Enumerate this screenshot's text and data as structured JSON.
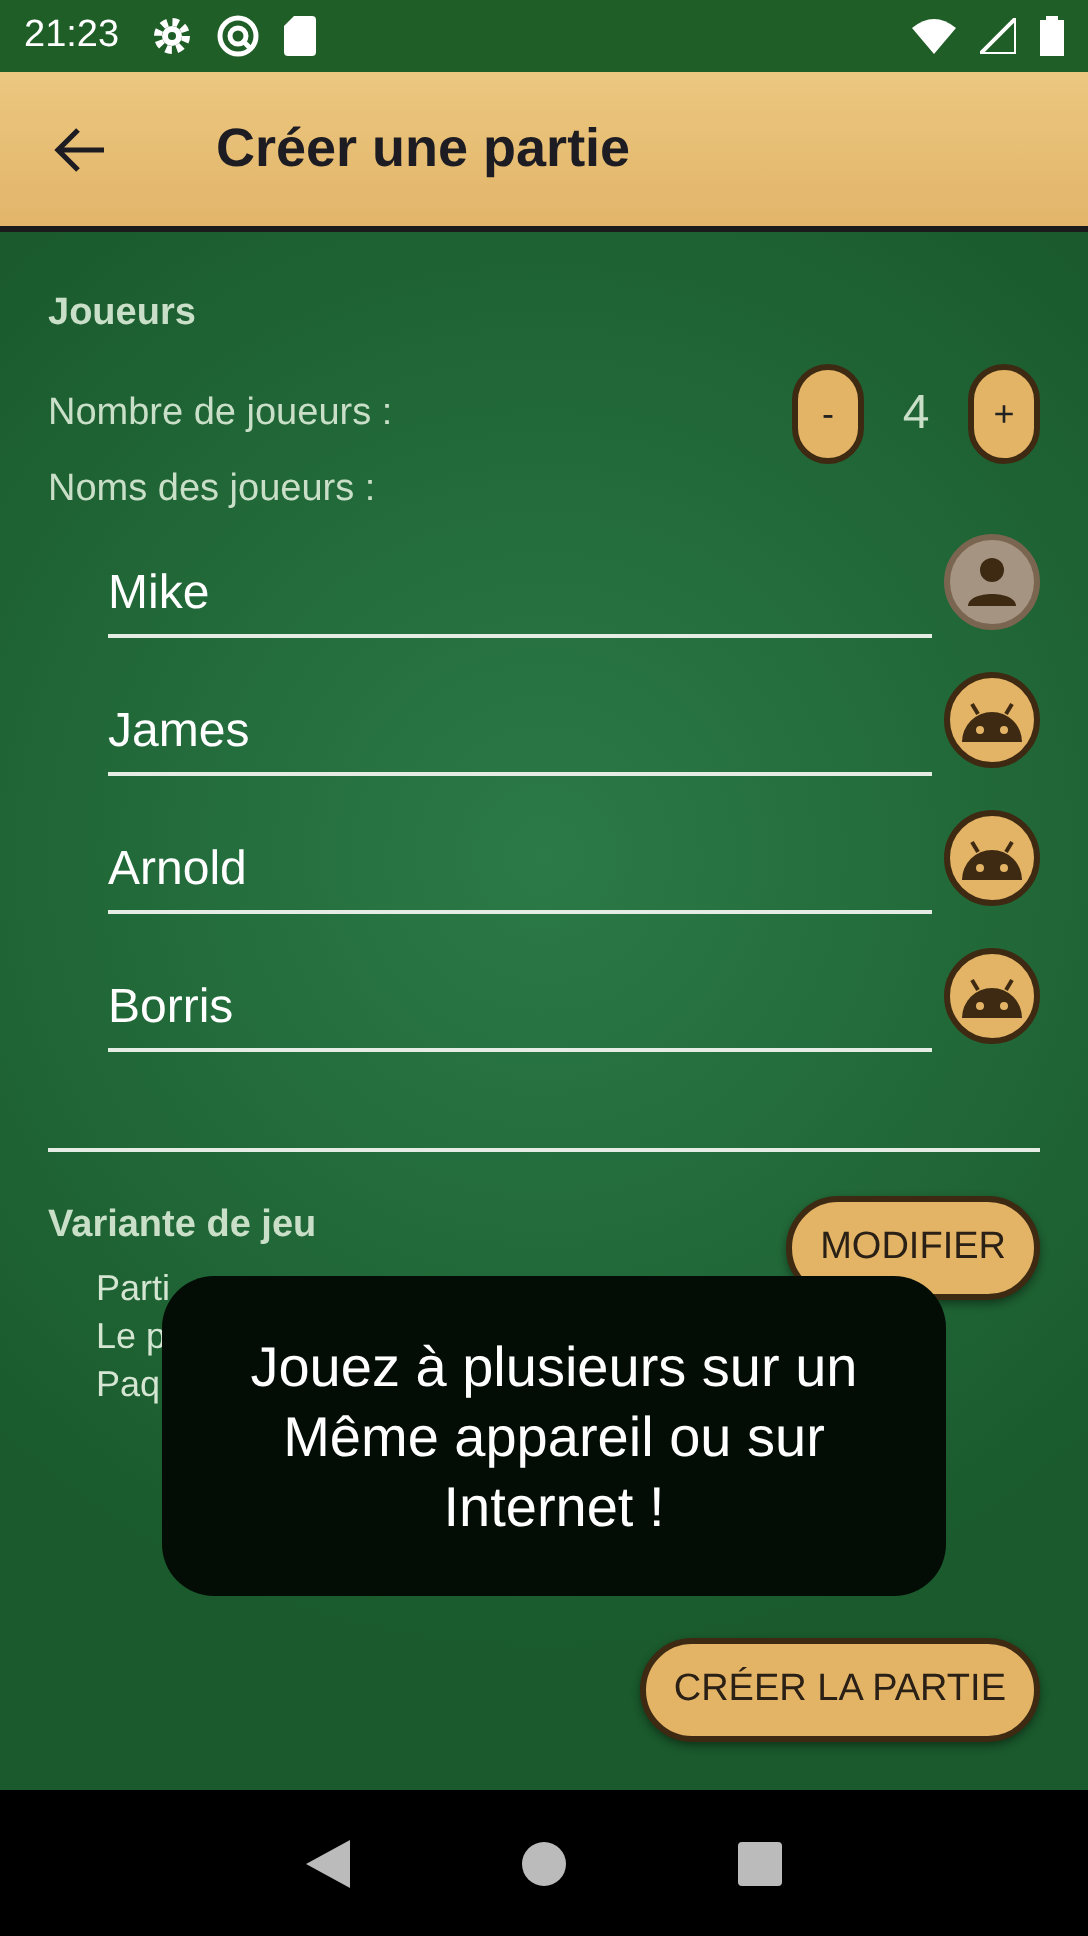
{
  "status_bar": {
    "time": "21:23"
  },
  "app_bar": {
    "title": "Créer une partie"
  },
  "players_section": {
    "heading": "Joueurs",
    "count_label": "Nombre de joueurs :",
    "decrement": "-",
    "count": "4",
    "increment": "+",
    "names_label": "Noms des joueurs :",
    "players": [
      {
        "name": "Mike",
        "kind": "human"
      },
      {
        "name": "James",
        "kind": "bot"
      },
      {
        "name": "Arnold",
        "kind": "bot"
      },
      {
        "name": "Borris",
        "kind": "bot"
      }
    ]
  },
  "variant_section": {
    "heading": "Variante de jeu",
    "modify_button": "MODIFIER",
    "lines": [
      "Parti",
      "Le p",
      "Paq"
    ]
  },
  "create_button": "CRÉER LA PARTIE",
  "toast": {
    "text": "Jouez à plusieurs sur un Même appareil ou sur Internet !"
  }
}
